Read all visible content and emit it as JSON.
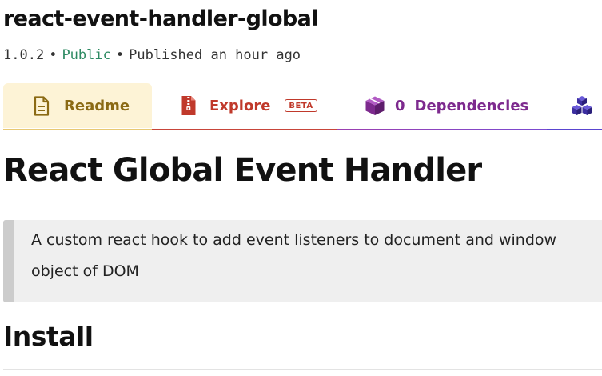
{
  "package": {
    "name": "react-event-handler-global",
    "version": "1.0.2",
    "visibility": "Public",
    "published": "Published an hour ago",
    "separator": "•"
  },
  "tabs": [
    {
      "label": "Readme",
      "icon": "readme-file-icon",
      "active": true,
      "color": "#8b6a14"
    },
    {
      "label": "Explore",
      "badge": "BETA",
      "icon": "zip-file-icon",
      "active": false,
      "color": "#c0392b"
    },
    {
      "count": "0",
      "label": "Dependencies",
      "icon": "box-icon",
      "active": false,
      "color": "#7d2a8e"
    },
    {
      "icon": "boxes-icon",
      "active": false,
      "color": "#3c2ea0"
    }
  ],
  "readme": {
    "title": "React Global Event Handler",
    "description": "A custom react hook to add event listeners to document and window object of DOM",
    "install_heading": "Install"
  },
  "colors": {
    "public": "#2d8a62",
    "readme_tab_bg": "#fdf3d6",
    "blockquote_bg": "#efefef",
    "blockquote_border": "#cccccc"
  }
}
